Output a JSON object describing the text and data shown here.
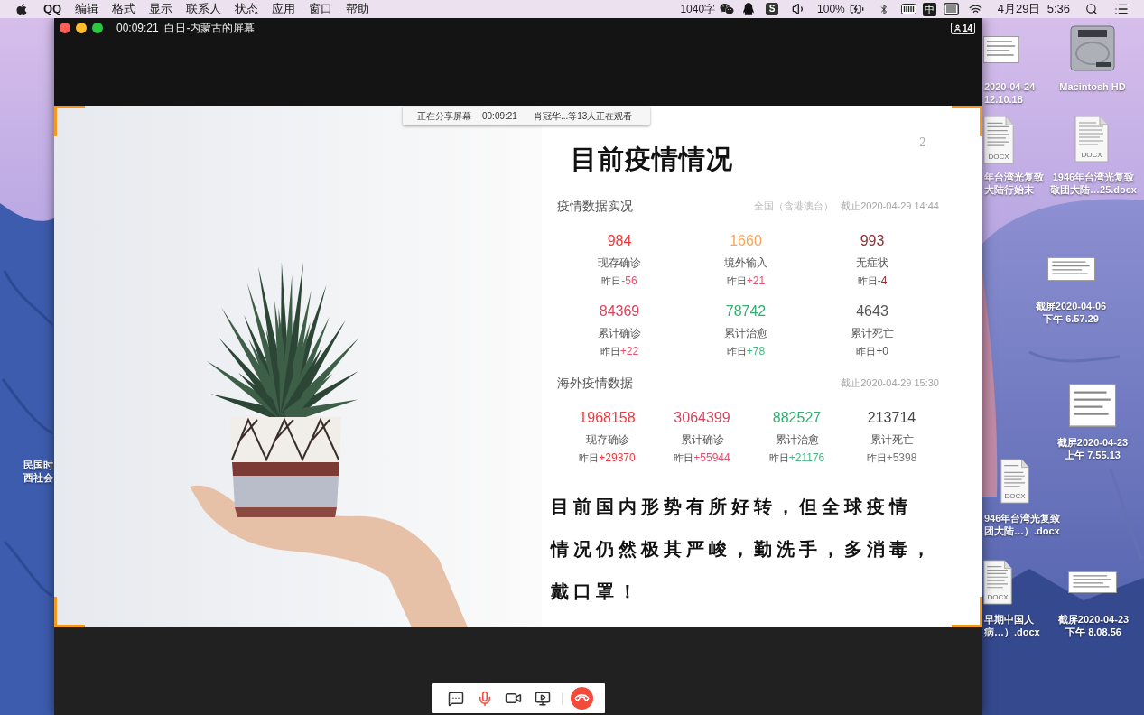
{
  "menu_bar": {
    "app_name": "QQ",
    "menus": [
      "编辑",
      "格式",
      "显示",
      "联系人",
      "状态",
      "应用",
      "窗口",
      "帮助"
    ],
    "word_count": "1040字",
    "input_source": "S",
    "battery": "100%",
    "input_method": "中",
    "clock": "4月29日  5:36"
  },
  "desktop_icons": [
    {
      "kind": "screenshot",
      "label_lines": [
        "2020-04-24",
        "12.10.18"
      ]
    },
    {
      "kind": "disk",
      "label_lines": [
        "Macintosh HD"
      ]
    },
    {
      "kind": "docx",
      "badge": "DOCX",
      "label_lines": [
        "年台湾光复致",
        "大陆行始末"
      ]
    },
    {
      "kind": "docx",
      "badge": "DOCX",
      "label_lines": [
        "1946年台湾光复致",
        "敬团大陆…25.docx"
      ]
    },
    {
      "kind": "screenshot",
      "label_lines": [
        "截屏2020-04-06",
        "下午 6.57.29"
      ]
    },
    {
      "kind": "screenshot",
      "label_lines": [
        "截屏2020-04-23",
        "上午 7.55.13"
      ]
    },
    {
      "kind": "docx",
      "badge": "DOCX",
      "label_lines": [
        "946年台湾光复致",
        "团大陆…）.docx"
      ]
    },
    {
      "kind": "docx",
      "badge": "DOCX",
      "label_lines": [
        "早期中国人",
        "病…）.docx"
      ]
    },
    {
      "kind": "screenshot",
      "label_lines": [
        "截屏2020-04-23",
        "下午 8.08.56"
      ]
    },
    {
      "kind": "covered",
      "label_lines": [
        "民国时",
        "西社会"
      ]
    }
  ],
  "window": {
    "title": "00:09:21  白日-内蒙古的屏幕",
    "participant_count": "14"
  },
  "share_banner": {
    "status": "正在分享屏幕",
    "duration": "00:09:21",
    "viewers": "肖冠华...等13人正在观看"
  },
  "slide": {
    "page_number": "2",
    "title": "目前疫情情况",
    "domestic": {
      "heading": "疫情数据实况",
      "scope": "全国（含港澳台）",
      "updated": "截止2020-04-29 14:44",
      "stats": [
        {
          "value": "984",
          "label": "现存确诊",
          "yesterday": "昨日",
          "color": "#f0383c",
          "change": {
            "text": "-56",
            "color": "#e8506e"
          }
        },
        {
          "value": "1660",
          "label": "境外输入",
          "yesterday": "昨日",
          "color": "#f7a65a",
          "change": {
            "text": "+21",
            "color": "#e8506e"
          }
        },
        {
          "value": "993",
          "label": "无症状",
          "yesterday": "昨日",
          "color": "#8a3238",
          "change": {
            "text": "-4",
            "color": "#8a3238"
          }
        },
        {
          "value": "84369",
          "label": "累计确诊",
          "yesterday": "昨日",
          "color": "#d6445e",
          "change": {
            "text": "+22",
            "color": "#e8506e"
          }
        },
        {
          "value": "78742",
          "label": "累计治愈",
          "yesterday": "昨日",
          "color": "#35ad72",
          "change": {
            "text": "+78",
            "color": "#45b884"
          }
        },
        {
          "value": "4643",
          "label": "累计死亡",
          "yesterday": "昨日",
          "color": "#555555",
          "change": {
            "text": "+0",
            "color": "#555555"
          }
        }
      ]
    },
    "overseas": {
      "heading": "海外疫情数据",
      "updated": "截止2020-04-29 15:30",
      "stats": [
        {
          "value": "1968158",
          "label": "现存确诊",
          "yesterday": "昨日",
          "color": "#f2373e",
          "change": {
            "text": "+29370",
            "color": "#f2373e"
          }
        },
        {
          "value": "3064399",
          "label": "累计确诊",
          "yesterday": "昨日",
          "color": "#d6445e",
          "change": {
            "text": "+55944",
            "color": "#e0506e"
          }
        },
        {
          "value": "882527",
          "label": "累计治愈",
          "yesterday": "昨日",
          "color": "#35ad72",
          "change": {
            "text": "+21176",
            "color": "#45b884"
          }
        },
        {
          "value": "213714",
          "label": "累计死亡",
          "yesterday": "昨日",
          "color": "#444444",
          "change": {
            "text": "+5398",
            "color": "#777777"
          }
        }
      ]
    },
    "message_lines": [
      "目前国内形势有所好转，但全球疫情",
      "情况仍然极其严峻，勤洗手，多消毒，",
      "戴口罩！"
    ]
  }
}
